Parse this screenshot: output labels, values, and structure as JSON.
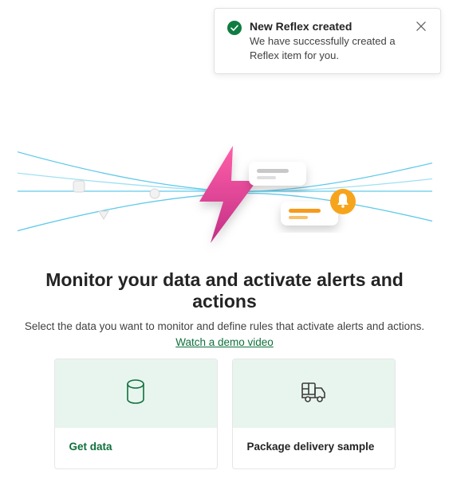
{
  "toast": {
    "title": "New Reflex created",
    "message": "We have successfully created a Reflex item for you."
  },
  "hero": {
    "headline": "Monitor your data and activate alerts and actions",
    "subhead": "Select the data you want to monitor and define rules that activate alerts and actions.",
    "demo_link": "Watch a demo video"
  },
  "cards": [
    {
      "label": "Get data",
      "icon": "database-icon",
      "accent": true
    },
    {
      "label": "Package delivery sample",
      "icon": "package-truck-icon",
      "accent": false
    }
  ],
  "colors": {
    "accent_green": "#0f703b",
    "bolt_pink_top": "#e93a8f",
    "bolt_pink_bottom": "#b6297c",
    "bell_orange": "#f7a41d",
    "line_cyan": "#4fc4e8"
  }
}
